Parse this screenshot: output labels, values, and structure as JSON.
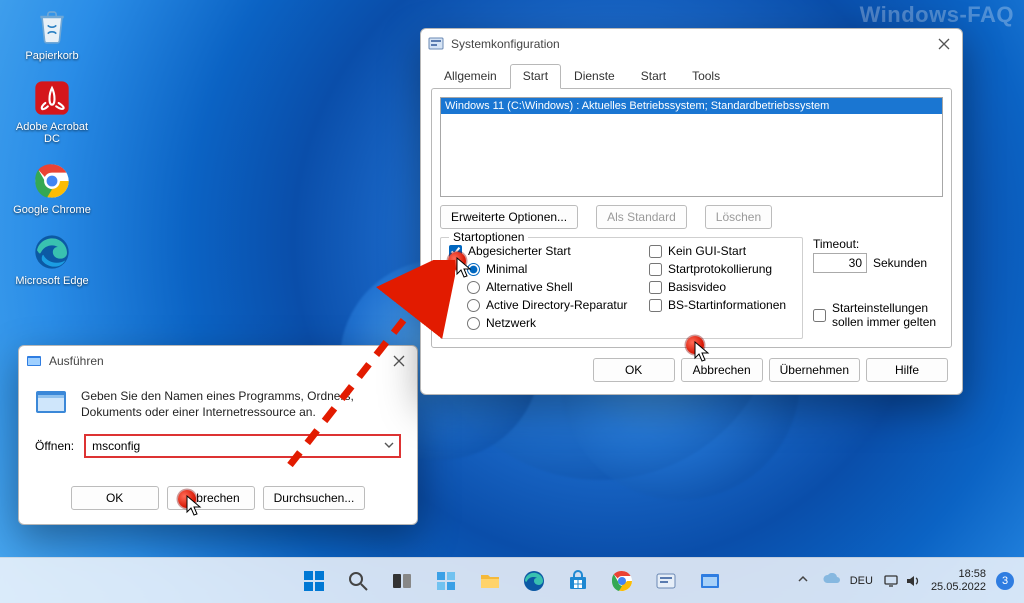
{
  "watermark": "Windows-FAQ",
  "desktop": {
    "icons": [
      {
        "id": "recycle-bin",
        "label": "Papierkorb"
      },
      {
        "id": "acrobat",
        "label": "Adobe Acrobat DC"
      },
      {
        "id": "chrome",
        "label": "Google Chrome"
      },
      {
        "id": "edge",
        "label": "Microsoft Edge"
      }
    ]
  },
  "run_dialog": {
    "title": "Ausführen",
    "description": "Geben Sie den Namen eines Programms, Ordners, Dokuments oder einer Internetressource an.",
    "open_label": "Öffnen:",
    "open_value": "msconfig",
    "buttons": {
      "ok": "OK",
      "cancel": "Abbrechen",
      "browse": "Durchsuchen..."
    }
  },
  "sysconfig": {
    "title": "Systemkonfiguration",
    "tabs": [
      "Allgemein",
      "Start",
      "Dienste",
      "Start",
      "Tools"
    ],
    "active_tab_index": 1,
    "os_entry": "Windows 11 (C:\\Windows) : Aktuelles Betriebssystem; Standardbetriebssystem",
    "mid_buttons": {
      "advanced": "Erweiterte Optionen...",
      "default": "Als Standard",
      "delete": "Löschen"
    },
    "startoptionen_legend": "Startoptionen",
    "safe_boot": {
      "label": "Abgesicherter Start",
      "checked": true,
      "modes": {
        "minimal": "Minimal",
        "altshell": "Alternative Shell",
        "adrepair": "Active Directory-Reparatur",
        "network": "Netzwerk"
      },
      "selected_mode": "minimal"
    },
    "right_checks": {
      "nogui": "Kein GUI-Start",
      "bootlog": "Startprotokollierung",
      "basevideo": "Basisvideo",
      "osbootinfo": "BS-Startinformationen"
    },
    "timeout": {
      "label": "Timeout:",
      "value": "30",
      "unit": "Sekunden"
    },
    "persist_label": "Starteinstellungen sollen immer gelten",
    "dlg_buttons": {
      "ok": "OK",
      "cancel": "Abbrechen",
      "apply": "Übernehmen",
      "help": "Hilfe"
    }
  },
  "taskbar": {
    "lang": "DEU",
    "time": "18:58",
    "date": "25.05.2022",
    "badge": "3"
  }
}
